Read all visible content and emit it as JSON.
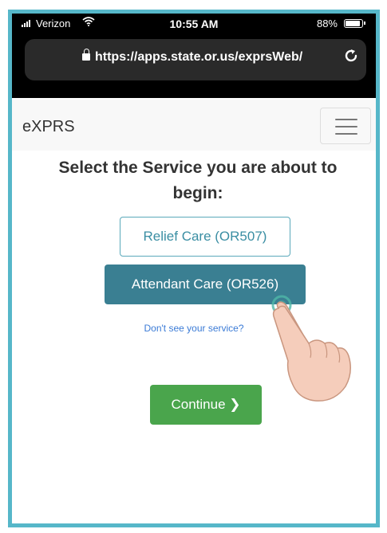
{
  "status_bar": {
    "carrier": "Verizon",
    "time": "10:55 AM",
    "battery": "88%"
  },
  "browser": {
    "url": "https://apps.state.or.us/exprsWeb/"
  },
  "navbar": {
    "brand": "eXPRS"
  },
  "page": {
    "heading": "Select the Service you are about to begin:",
    "services": [
      {
        "label": "Relief Care (OR507)"
      },
      {
        "label": "Attendant Care (OR526)"
      }
    ],
    "help_link": "Don't see your service?",
    "continue_label": "Continue",
    "continue_icon": "❯"
  },
  "colors": {
    "frame_border": "#56b7c9",
    "outline_button": "#3a8ea3",
    "selected_button": "#3a7f92",
    "continue_button": "#4aa54c",
    "link": "#3b7bd6"
  }
}
